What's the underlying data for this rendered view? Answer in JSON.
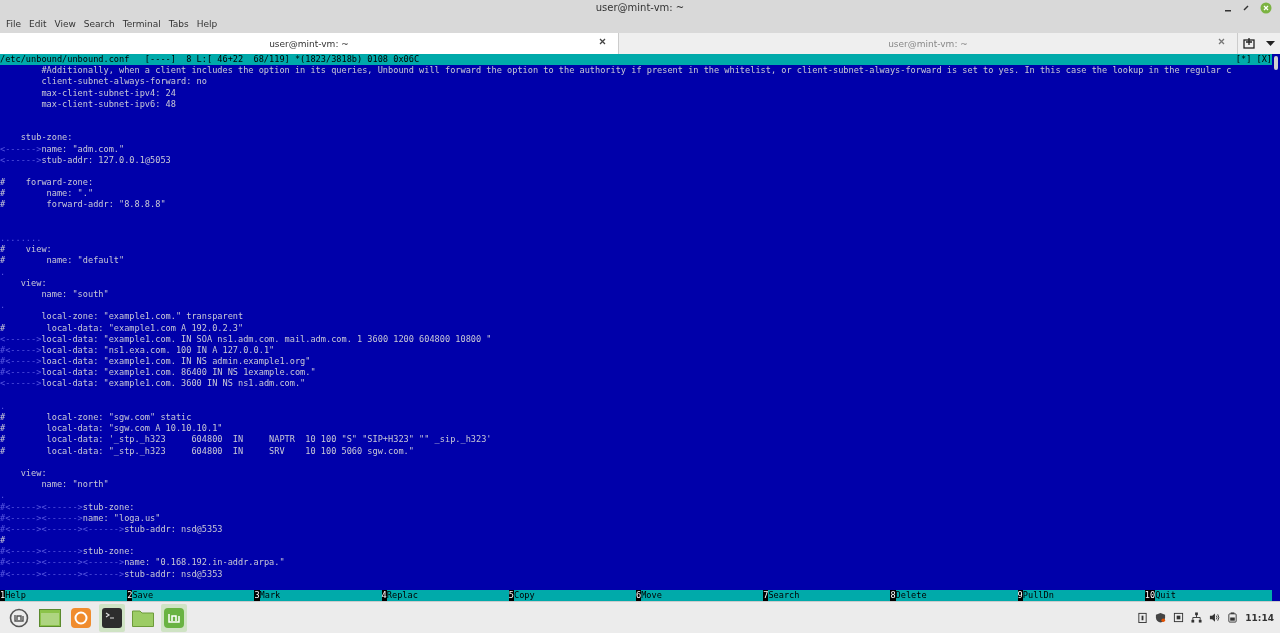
{
  "window": {
    "title": "user@mint-vm: ~"
  },
  "menu": [
    "File",
    "Edit",
    "View",
    "Search",
    "Terminal",
    "Tabs",
    "Help"
  ],
  "tabs": [
    {
      "label": "user@mint-vm: ~",
      "selected": true
    },
    {
      "label": "user@mint-vm: ~",
      "selected": false
    }
  ],
  "editor": {
    "status": {
      "info": "/etc/unbound/unbound.conf   [----]  8 L:[ 46+22  68/119] *(1823/3818b) 0108 0x06C",
      "flags": "[*] [X]"
    },
    "lines": [
      {
        "kind": "code",
        "text": "        #Additionally, when a client includes the option in its queries, Unbound will forward the option to the authority if present in the whitelist, or client-subnet-always-forward is set to yes. In this case the lookup in the regular c"
      },
      {
        "kind": "code",
        "text": "        client-subnet-always-forward: no"
      },
      {
        "kind": "code",
        "text": "        max-client-subnet-ipv4: 24"
      },
      {
        "kind": "code",
        "text": "        max-client-subnet-ipv6: 48"
      },
      {
        "kind": "blank"
      },
      {
        "kind": "blank"
      },
      {
        "kind": "code",
        "text": "    stub-zone:"
      },
      {
        "kind": "code",
        "lead": "<------>",
        "text": "name: \"adm.com.\""
      },
      {
        "kind": "code",
        "lead": "<------>",
        "text": "stub-addr: 127.0.0.1@5053"
      },
      {
        "kind": "blank"
      },
      {
        "kind": "code",
        "text": "#    forward-zone:"
      },
      {
        "kind": "code",
        "text": "#        name: \".\""
      },
      {
        "kind": "code",
        "text": "#        forward-addr: \"8.8.8.8\""
      },
      {
        "kind": "blank"
      },
      {
        "kind": "blank"
      },
      {
        "kind": "code",
        "lead": "........"
      },
      {
        "kind": "code",
        "text": "#    view:"
      },
      {
        "kind": "code",
        "text": "#        name: \"default\""
      },
      {
        "kind": "code",
        "lead": "."
      },
      {
        "kind": "code",
        "text": "    view:"
      },
      {
        "kind": "code",
        "text": "        name: \"south\""
      },
      {
        "kind": "code",
        "lead": "."
      },
      {
        "kind": "code",
        "text": "        local-zone: \"example1.com.\" transparent"
      },
      {
        "kind": "code",
        "text": "#        local-data: \"example1.com A 192.0.2.3\""
      },
      {
        "kind": "code",
        "lead": "<------>",
        "text": "local-data: \"example1.com. IN SOA ns1.adm.com. mail.adm.com. 1 3600 1200 604800 10800 \""
      },
      {
        "kind": "code",
        "lead": "#<----->",
        "text": "local-data: \"ns1.exa.com. 100 IN A 127.0.0.1\""
      },
      {
        "kind": "code",
        "lead": "#<----->",
        "text": "loacl-data: \"example1.com. IN NS admin.example1.org\""
      },
      {
        "kind": "code",
        "lead": "#<----->",
        "text": "local-data: \"example1.com. 86400 IN NS 1example.com.\""
      },
      {
        "kind": "code",
        "lead": "<------>",
        "text": "local-data: \"example1.com. 3600 IN NS ns1.adm.com.\""
      },
      {
        "kind": "blank"
      },
      {
        "kind": "code",
        "lead": "."
      },
      {
        "kind": "code",
        "text": "#        local-zone: \"sgw.com\" static"
      },
      {
        "kind": "code",
        "text": "#        local-data: \"sgw.com A 10.10.10.1\""
      },
      {
        "kind": "code",
        "text": "#        local-data: '_stp._h323     604800  IN     NAPTR  10 100 \"S\" \"SIP+H323\" \"\" _sip._h323'"
      },
      {
        "kind": "code",
        "text": "#        local-data: \"_stp._h323     604800  IN     SRV    10 100 5060 sgw.com.\""
      },
      {
        "kind": "blank"
      },
      {
        "kind": "code",
        "text": "    view:"
      },
      {
        "kind": "code",
        "text": "        name: \"north\""
      },
      {
        "kind": "code",
        "lead": "."
      },
      {
        "kind": "code",
        "lead": "#<-----><------>",
        "text": "stub-zone:"
      },
      {
        "kind": "code",
        "lead": "#<-----><------>",
        "text": "name: \"loga.us\""
      },
      {
        "kind": "code",
        "lead": "#<-----><------><------>",
        "text": "stub-addr: nsd@5353"
      },
      {
        "kind": "code",
        "text": "#"
      },
      {
        "kind": "code",
        "lead": "#<-----><------>",
        "text": "stub-zone:"
      },
      {
        "kind": "code",
        "lead": "#<-----><------><------>",
        "text": "name: \"0.168.192.in-addr.arpa.\""
      },
      {
        "kind": "code",
        "lead": "#<-----><------><------>",
        "text": "stub-addr: nsd@5353"
      }
    ]
  },
  "function_keys": [
    {
      "key": "1",
      "label": "Help"
    },
    {
      "key": "2",
      "label": "Save"
    },
    {
      "key": "3",
      "label": "Mark"
    },
    {
      "key": "4",
      "label": "Replac"
    },
    {
      "key": "5",
      "label": "Copy"
    },
    {
      "key": "6",
      "label": "Move"
    },
    {
      "key": "7",
      "label": "Search"
    },
    {
      "key": "8",
      "label": "Delete"
    },
    {
      "key": "9",
      "label": "PullDn"
    },
    {
      "key": "10",
      "label": "Quit"
    }
  ],
  "taskbar": {
    "clock": "11:14"
  }
}
